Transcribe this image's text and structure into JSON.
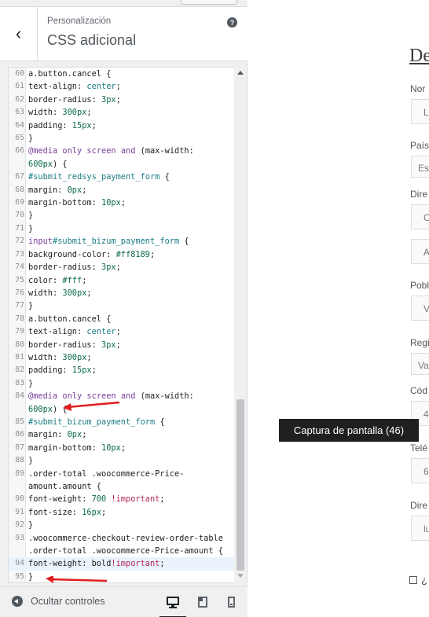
{
  "header": {
    "breadcrumb": "Personalización",
    "title": "CSS adicional"
  },
  "editor": {
    "lines": [
      {
        "n": "60",
        "html": "a.button.cancel {"
      },
      {
        "n": "61",
        "html": "text-align: <span class='n'>center</span>;"
      },
      {
        "n": "62",
        "html": "border-radius: <span class='v'>3px</span>;"
      },
      {
        "n": "63",
        "html": "width: <span class='v'>300px</span>;"
      },
      {
        "n": "64",
        "html": "padding: <span class='v'>15px</span>;"
      },
      {
        "n": "65",
        "html": "}"
      },
      {
        "n": "66",
        "html": "<span class='k'>@media</span> <span class='k'>only</span> <span class='k'>screen</span> <span class='k'>and</span> (max-width:"
      },
      {
        "n": "",
        "html": "<span class='v'>600px</span>) {"
      },
      {
        "n": "67",
        "html": "<span class='n'>#submit_redsys_payment_form</span> {"
      },
      {
        "n": "68",
        "html": "margin: <span class='v'>0px</span>;"
      },
      {
        "n": "69",
        "html": "margin-bottom: <span class='v'>10px</span>;"
      },
      {
        "n": "70",
        "html": "}"
      },
      {
        "n": "71",
        "html": "}"
      },
      {
        "n": "72",
        "html": "<span class='k'>input</span><span class='n'>#submit_bizum_payment_form</span> {"
      },
      {
        "n": "73",
        "html": "background-color: <span class='v'>#ff8189</span>;"
      },
      {
        "n": "74",
        "html": "border-radius: <span class='v'>3px</span>;"
      },
      {
        "n": "75",
        "html": "color: <span class='v'>#fff</span>;"
      },
      {
        "n": "76",
        "html": "width: <span class='v'>300px</span>;"
      },
      {
        "n": "77",
        "html": "}"
      },
      {
        "n": "78",
        "html": "a.button.cancel {"
      },
      {
        "n": "79",
        "html": "text-align: <span class='n'>center</span>;"
      },
      {
        "n": "80",
        "html": "border-radius: <span class='v'>3px</span>;"
      },
      {
        "n": "81",
        "html": "width: <span class='v'>300px</span>;"
      },
      {
        "n": "82",
        "html": "padding: <span class='v'>15px</span>;"
      },
      {
        "n": "83",
        "html": "}"
      },
      {
        "n": "84",
        "html": "<span class='k'>@media</span> <span class='k'>only</span> <span class='k'>screen</span> <span class='k'>and</span> (max-width:"
      },
      {
        "n": "",
        "html": "<span class='v'>600px</span>) {"
      },
      {
        "n": "85",
        "html": "<span class='n'>#submit_bizum_payment_form</span> {"
      },
      {
        "n": "86",
        "html": "margin: <span class='v'>0px</span>;"
      },
      {
        "n": "87",
        "html": "margin-bottom: <span class='v'>10px</span>;"
      },
      {
        "n": "88",
        "html": "}"
      },
      {
        "n": "89",
        "html": ".order-total .woocommerce-Price-"
      },
      {
        "n": "",
        "html": "amount.amount {"
      },
      {
        "n": "90",
        "html": "font-weight: <span class='v'>700</span> <span class='imp'>!important</span>;"
      },
      {
        "n": "91",
        "html": "font-size: <span class='v'>16px</span>;"
      },
      {
        "n": "92",
        "html": "}"
      },
      {
        "n": "93",
        "html": ".woocommerce-checkout-review-order-table"
      },
      {
        "n": "",
        "html": ".order-total .woocommerce-Price-amount {"
      },
      {
        "n": "94",
        "html": "font-weight: bold<span class='imp'>!important</span>;",
        "active": true
      },
      {
        "n": "95",
        "html": "}"
      }
    ]
  },
  "footer": {
    "hide_controls": "Ocultar controles"
  },
  "preview": {
    "title": "De",
    "labels": [
      "Nor",
      "País",
      "Dire",
      "Pobl",
      "Regi",
      "Cód",
      "Telé",
      "Dire"
    ],
    "inputs": [
      "Lu",
      "Esp",
      "C",
      "A",
      "V",
      "Va",
      "4",
      "6",
      "lu"
    ],
    "checkbox_label": "¿"
  },
  "tooltip": "Captura de pantalla (46)"
}
